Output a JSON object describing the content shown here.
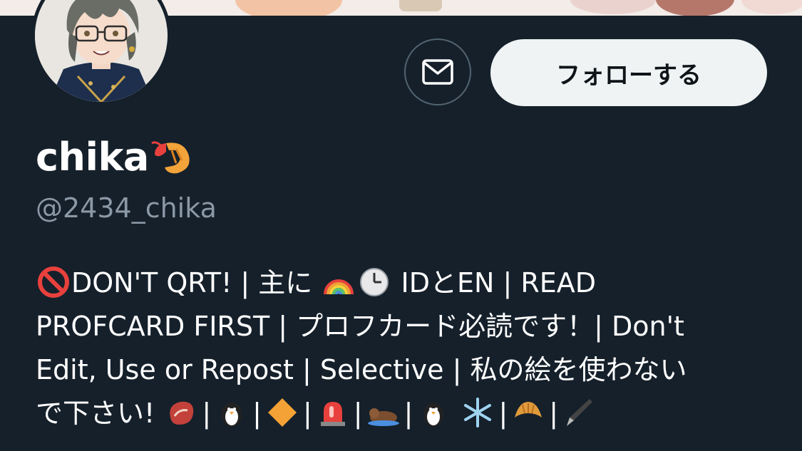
{
  "profile": {
    "display_name": "chika",
    "display_name_emoji_icon": "shrimp-icon",
    "handle": "@2434_chika"
  },
  "actions": {
    "message_icon": "envelope-icon",
    "follow_label": "フォローする"
  },
  "bio": {
    "line1_a": "DON'T QRT! | 主に",
    "line1_b": "IDとEN | READ",
    "line2": "PROFCARD FIRST | プロフカード必読です！| Don't",
    "line3": "Edit, Use or Repost | Selective | 私の絵を使わない",
    "line4_a": "で下さい!",
    "icons": [
      "no-entry-icon",
      "rainbow-icon",
      "clock-icon",
      "meat-icon",
      "penguin-icon",
      "orange-diamond-icon",
      "siren-icon",
      "otter-icon",
      "penguin-icon",
      "snowflake-icon",
      "croissant-icon",
      "fountain-pen-icon"
    ],
    "separator": "|"
  },
  "colors": {
    "background": "#15202b",
    "follow_button_bg": "#eff3f4",
    "handle_text": "#8b98a5",
    "border": "#536471"
  }
}
